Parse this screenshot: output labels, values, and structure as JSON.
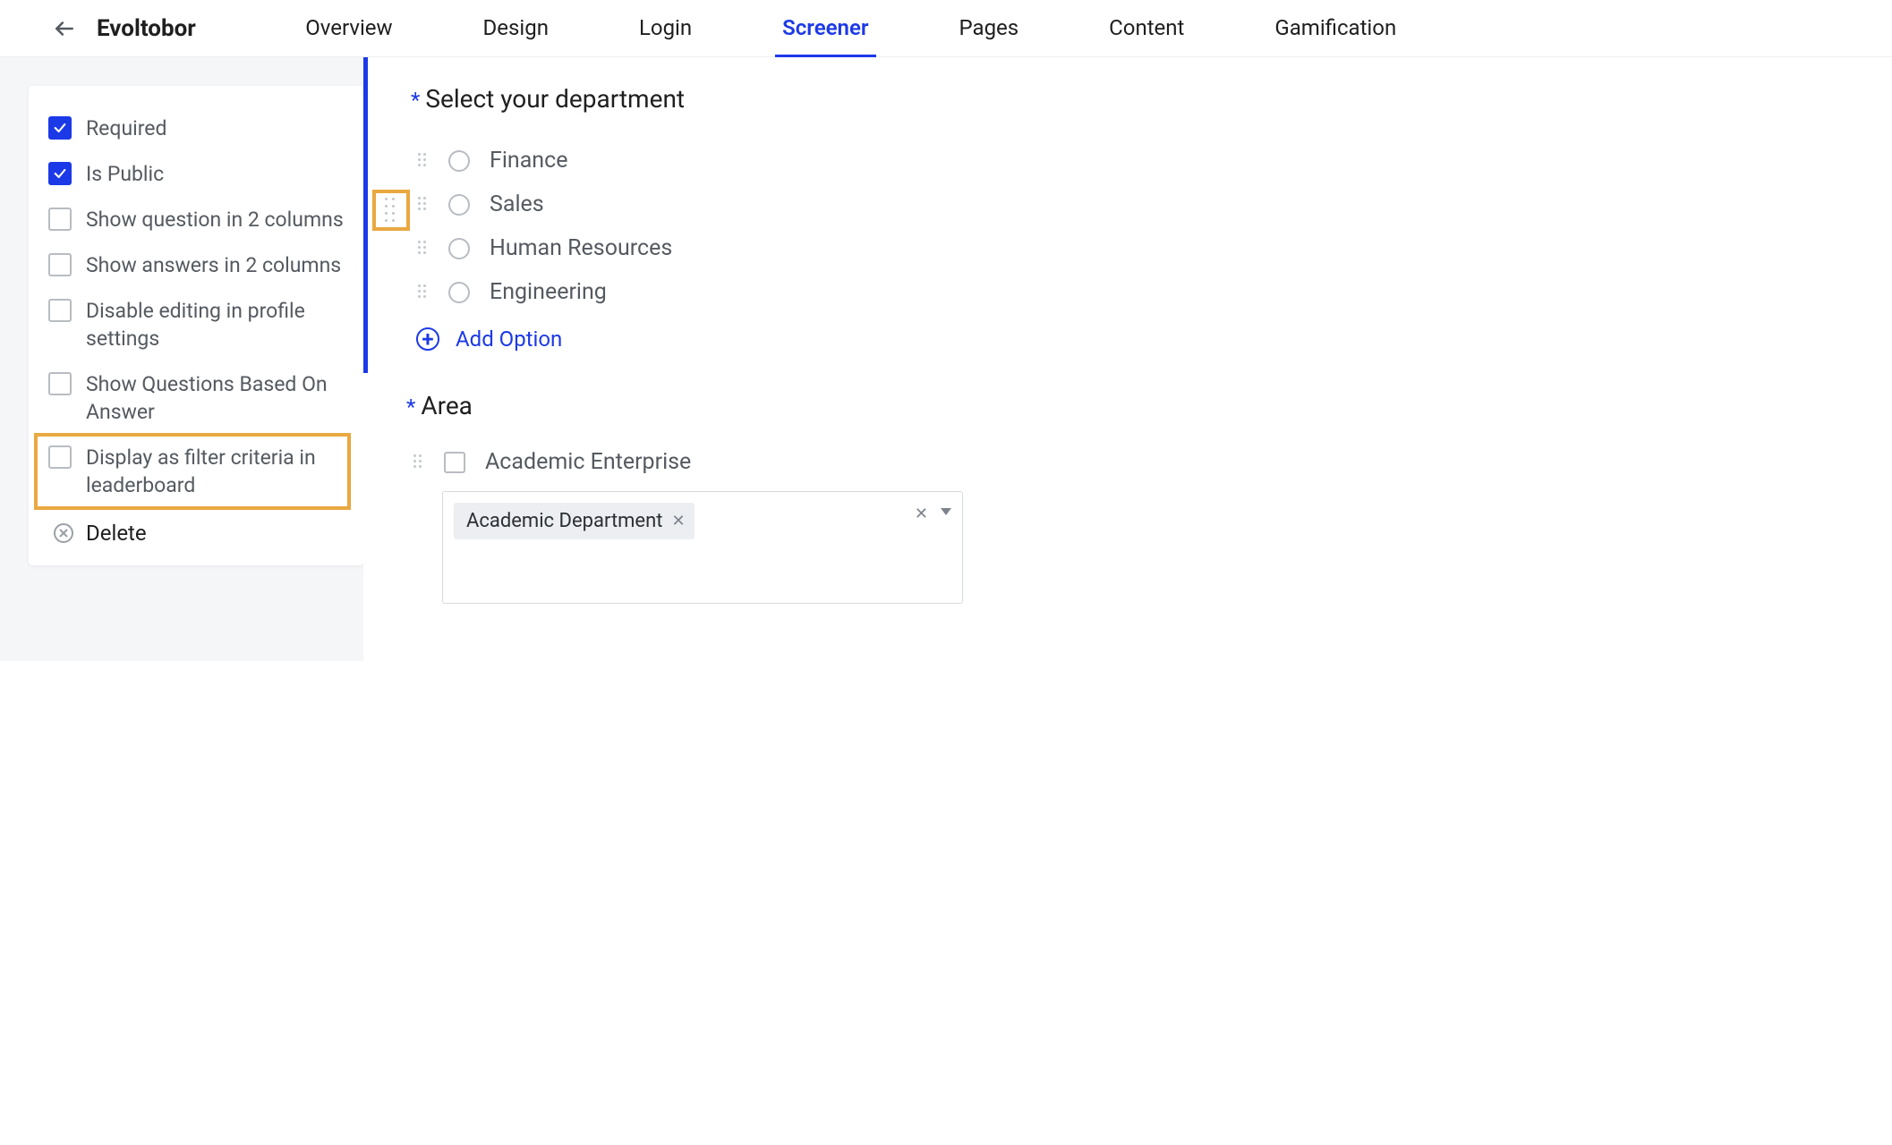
{
  "header": {
    "brand": "Evoltobor",
    "tabs": [
      "Overview",
      "Design",
      "Login",
      "Screener",
      "Pages",
      "Content",
      "Gamification"
    ],
    "active_tab_index": 3
  },
  "sidebar": {
    "options": [
      {
        "label": "Required",
        "checked": true
      },
      {
        "label": "Is Public",
        "checked": true
      },
      {
        "label": "Show question in 2 columns",
        "checked": false
      },
      {
        "label": "Show answers in 2 columns",
        "checked": false
      },
      {
        "label": "Disable editing in profile settings",
        "checked": false
      },
      {
        "label": "Show Questions Based On Answer",
        "checked": false
      },
      {
        "label": "Display as filter criteria in leaderboard",
        "checked": false
      }
    ],
    "highlighted_index": 6,
    "delete_label": "Delete"
  },
  "questions": {
    "q1": {
      "title": "Select your department",
      "options": [
        "Finance",
        "Sales",
        "Human Resources",
        "Engineering"
      ],
      "add_label": "Add Option"
    },
    "q2": {
      "title": "Area",
      "option_label": "Academic Enterprise",
      "tag_value": "Academic Department"
    }
  },
  "colors": {
    "accent": "#1C39E7",
    "highlight": "#E9A840"
  }
}
